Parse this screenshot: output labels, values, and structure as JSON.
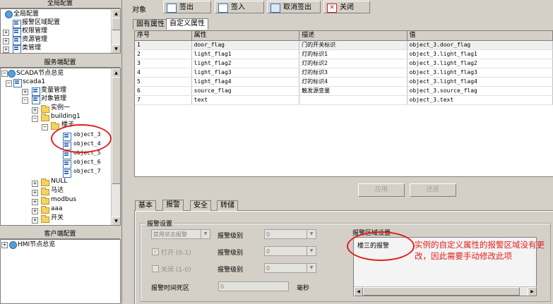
{
  "left": {
    "global_title": "全局配置",
    "global_items": [
      "报警区域配置",
      "权限管理",
      "资源管理",
      "类管理"
    ],
    "server_title": "服务端配置",
    "server_tree": {
      "root": "SCADA节点总览",
      "scada": "scada1",
      "var_mgmt": "变量管理",
      "obj_mgmt": "对象管理",
      "instance1": "实例一",
      "building1": "building1",
      "floor": "楼子",
      "objects": [
        "object_3",
        "object_4",
        "object_5",
        "object_6",
        "object_7"
      ],
      "null_node": "NULL",
      "motor": "马达",
      "modbus": "modbus",
      "aaa": "aaa",
      "switch": "开关"
    },
    "client_title": "客户端配置",
    "client_tree": {
      "root": "HMI节点总览"
    }
  },
  "toolbar": {
    "label": "对象",
    "checkout": "签出",
    "checkin": "签入",
    "cancel_checkout": "取消签出",
    "close": "关闭"
  },
  "attr_tabs": [
    "固有属性",
    "自定义属性"
  ],
  "grid": {
    "headers": [
      "序号",
      "属性",
      "描述",
      "值"
    ],
    "rows": [
      [
        "1",
        "door_flag",
        "门的开关标识",
        "object_3.door_flag"
      ],
      [
        "2",
        "light_flag1",
        "灯的标识1",
        "object_3.light_flag1"
      ],
      [
        "3",
        "light_flag2",
        "灯的标识2",
        "object_3.light_flag2"
      ],
      [
        "4",
        "light_flag3",
        "灯的标识3",
        "object_3.light_flag3"
      ],
      [
        "5",
        "light_flag4",
        "灯的标识4",
        "object_3.light_flag4"
      ],
      [
        "6",
        "source_flag",
        "触发源变量",
        "object_3.source_flag"
      ],
      [
        "7",
        "text",
        "",
        "object_3.text"
      ]
    ]
  },
  "buttons": {
    "apply": "应用",
    "restore": "还原"
  },
  "bottom_tabs": [
    "基本",
    "报警",
    "安全",
    "转储"
  ],
  "alarm": {
    "group_title": "报警设置",
    "status_combo": "禁用状态报警",
    "open_label": "打开 (0-1)",
    "close_label": "关闭 (1-0)",
    "level_label": "报警级别",
    "level_value": "0",
    "deadzone_label": "报警时间死区",
    "deadzone_value": "0",
    "deadzone_unit": "毫秒",
    "area_title": "报警区域设置",
    "area_item": "楼三的报警"
  },
  "annotation": "实例的自定义属性的报警区域没有更改，因此需要手动修改此项",
  "colors": {
    "annotation": "#e02020",
    "window_bg": "#d4d0c8"
  }
}
